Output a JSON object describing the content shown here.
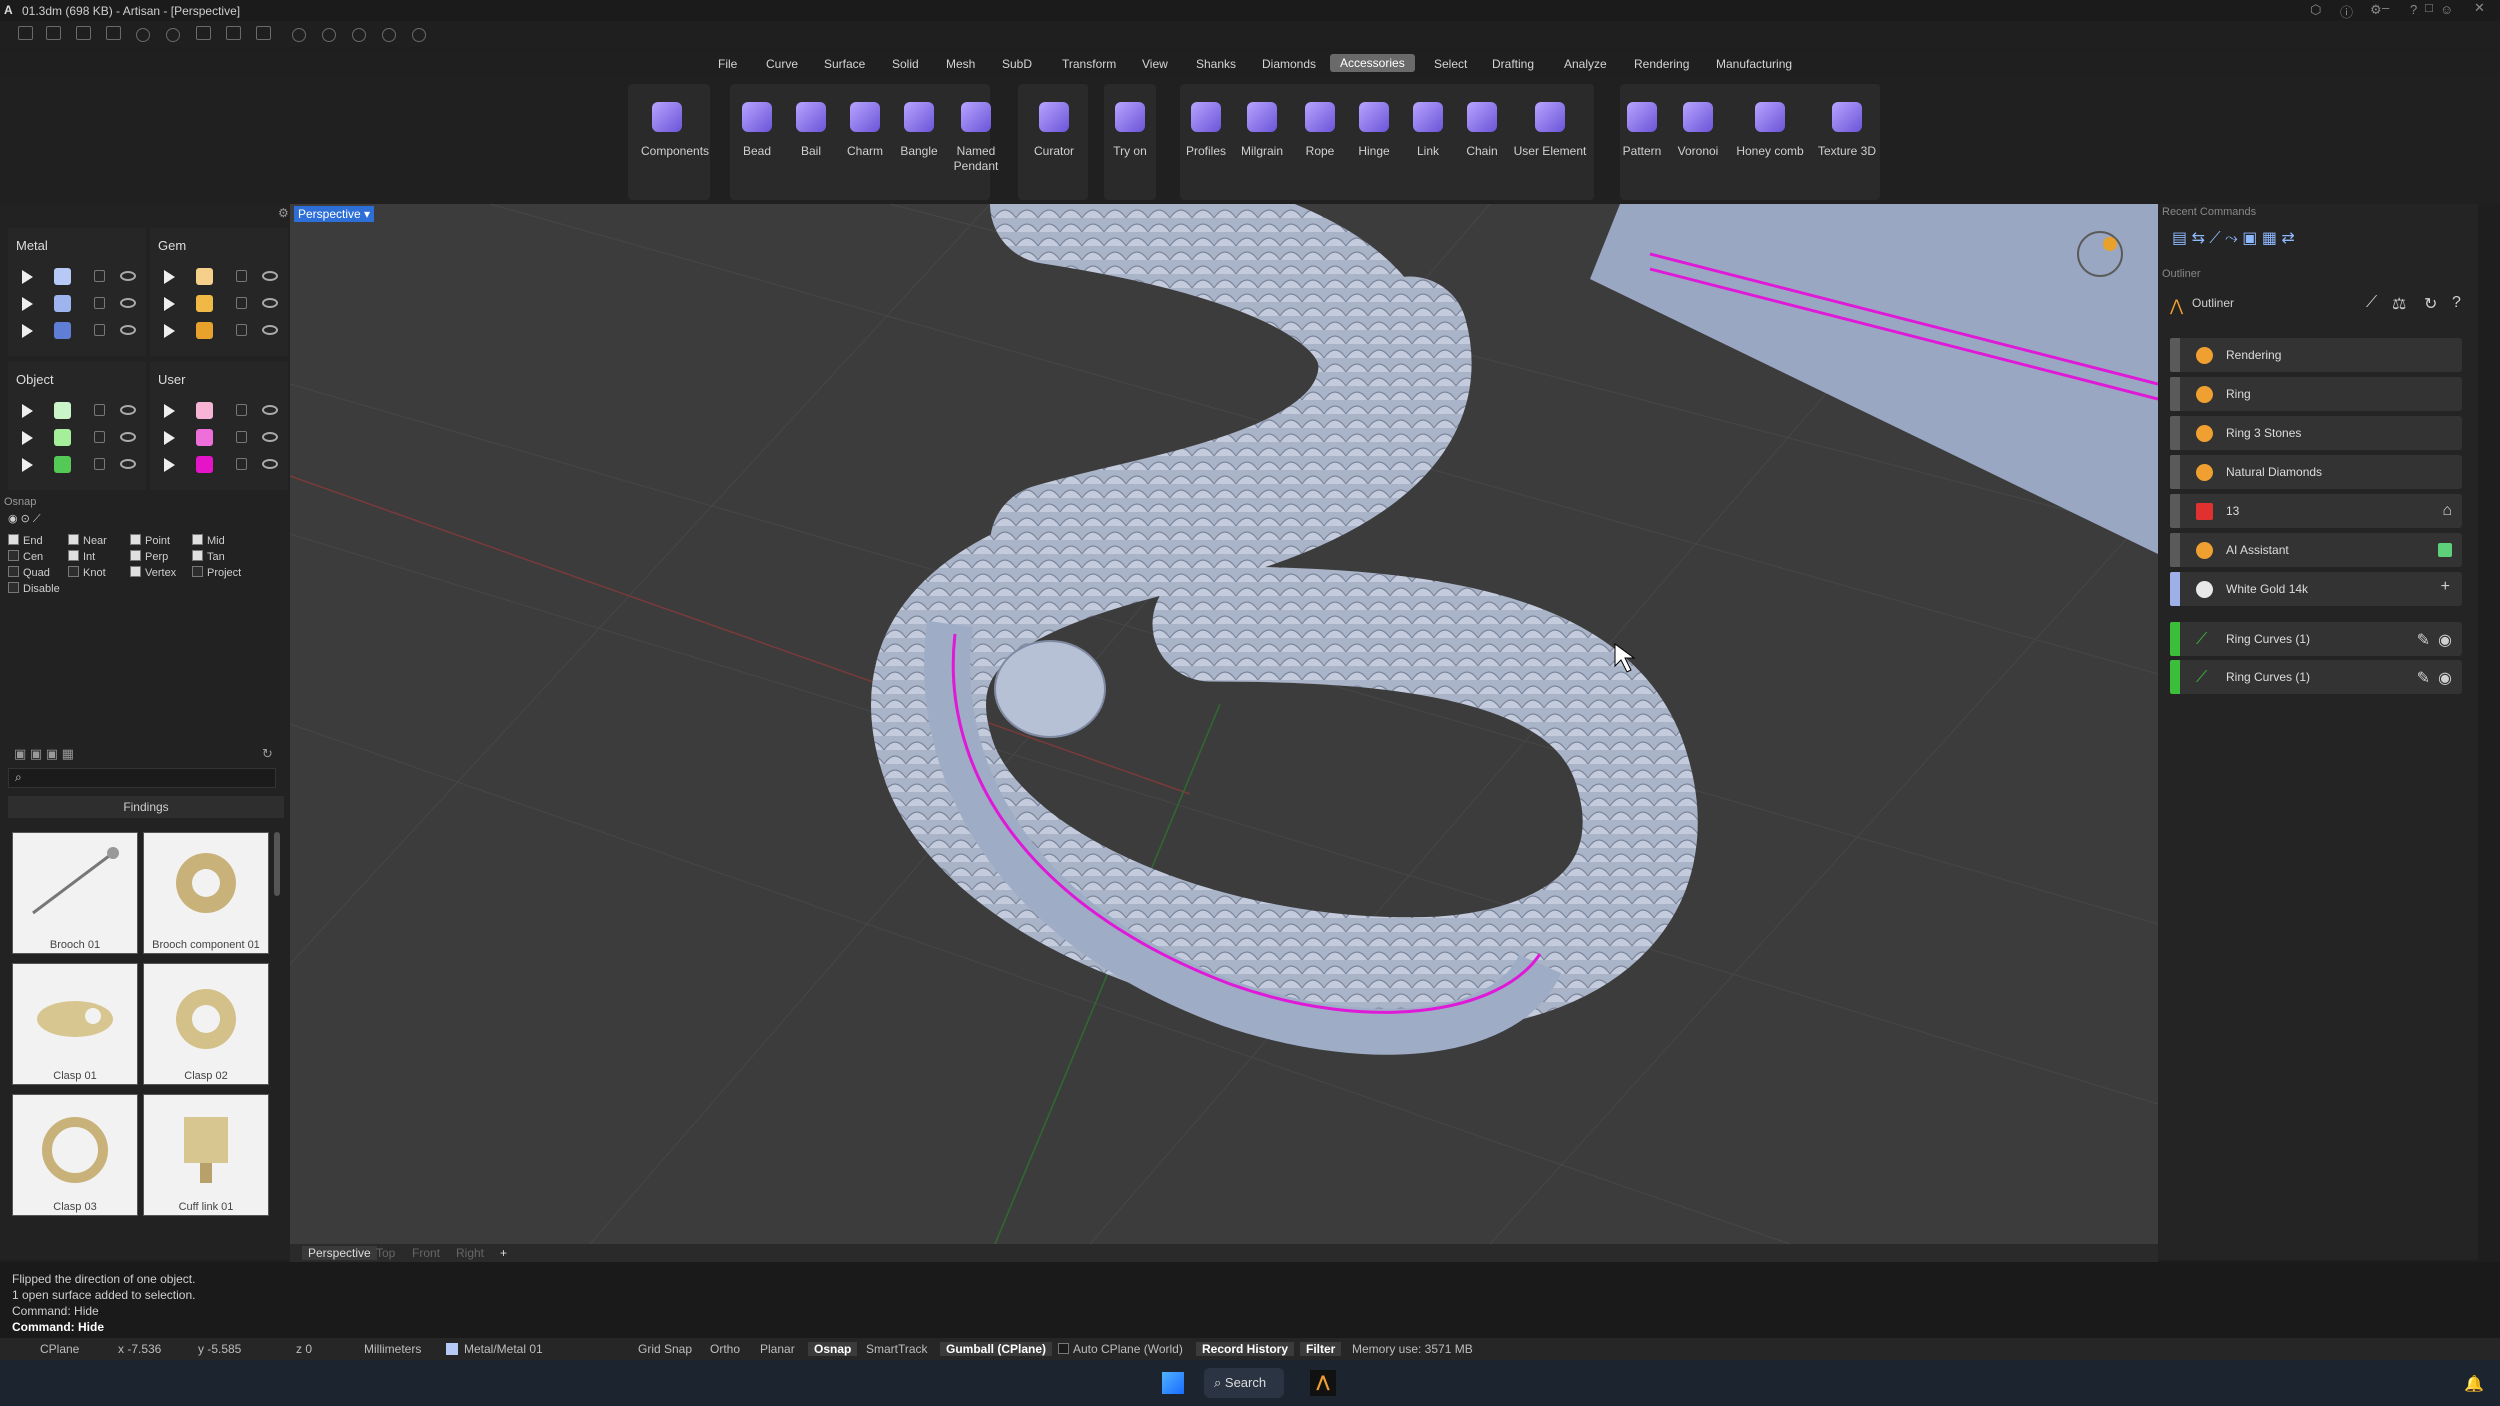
{
  "window": {
    "title": "01.3dm (698 KB) - Artisan - [Perspective]",
    "logo": "A"
  },
  "menubar": {
    "items": [
      "File",
      "Curve",
      "Surface",
      "Solid",
      "Mesh",
      "SubD",
      "Transform",
      "View",
      "Shanks",
      "Diamonds",
      "Accessories",
      "Select",
      "Drafting",
      "Analyze",
      "Rendering",
      "Manufacturing"
    ],
    "active": "Accessories"
  },
  "ribbon": {
    "buttons": [
      "Components",
      "Bead",
      "Bail",
      "Charm",
      "Bangle",
      "Named Pendant",
      "Curator",
      "Try on",
      "Profiles",
      "Milgrain",
      "Rope",
      "Hinge",
      "Link",
      "Chain",
      "User Element",
      "Pattern",
      "Voronoi",
      "Honey comb",
      "Texture 3D"
    ]
  },
  "layers": {
    "metal": {
      "title": "Metal",
      "swatches": [
        "#b7c9f5",
        "#9db4ee",
        "#5f7fd6"
      ]
    },
    "gem": {
      "title": "Gem",
      "swatches": [
        "#f5d08a",
        "#f0b945",
        "#e8a12a"
      ]
    },
    "object": {
      "title": "Object",
      "swatches": [
        "#c9f5c9",
        "#a6ef9a",
        "#55c955"
      ]
    },
    "user": {
      "title": "User",
      "swatches": [
        "#f7b4d4",
        "#ee6fd9",
        "#e614c8"
      ]
    }
  },
  "osnap": {
    "title": "Osnap",
    "items": [
      {
        "label": "End",
        "checked": true
      },
      {
        "label": "Near",
        "checked": true
      },
      {
        "label": "Point",
        "checked": true
      },
      {
        "label": "Mid",
        "checked": true
      },
      {
        "label": "Cen",
        "checked": false
      },
      {
        "label": "Int",
        "checked": true
      },
      {
        "label": "Perp",
        "checked": true
      },
      {
        "label": "Tan",
        "checked": true
      },
      {
        "label": "Quad",
        "checked": false
      },
      {
        "label": "Knot",
        "checked": false
      },
      {
        "label": "Vertex",
        "checked": true
      },
      {
        "label": "Project",
        "checked": false
      },
      {
        "label": "Disable",
        "checked": false
      }
    ]
  },
  "library": {
    "category": "Findings",
    "items": [
      "Brooch 01",
      "Brooch component 01",
      "Clasp 01",
      "Clasp 02",
      "Clasp 03",
      "Cuff link 01"
    ]
  },
  "viewport": {
    "label": "Perspective",
    "tabs": [
      "Perspective",
      "Top",
      "Front",
      "Right",
      "+"
    ]
  },
  "rightpanel": {
    "recent_title": "Recent Commands",
    "outliner_header": "Outliner",
    "outliner_title": "Outliner",
    "rows": [
      {
        "label": "Rendering",
        "bar": "#5a5a5a",
        "icon": "#f0a030"
      },
      {
        "label": "Ring",
        "bar": "#5a5a5a",
        "icon": "#f0a030"
      },
      {
        "label": "Ring 3 Stones",
        "bar": "#5a5a5a",
        "icon": "#f0a030"
      },
      {
        "label": "Natural Diamonds",
        "bar": "#5a5a5a",
        "icon": "#f0a030"
      },
      {
        "label": "13",
        "bar": "#5a5a5a",
        "icon": "#e03030"
      },
      {
        "label": "AI Assistant",
        "bar": "#5a5a5a",
        "icon": "#f0a030"
      },
      {
        "label": "White Gold 14k",
        "bar": "#9fb0e8",
        "icon": "#e8e8e8"
      },
      {
        "label": "Ring Curves (1)",
        "bar": "#3bbf3b",
        "icon": "#3bbf3b"
      },
      {
        "label": "Ring Curves (1)",
        "bar": "#3bbf3b",
        "icon": "#3bbf3b"
      }
    ]
  },
  "command": {
    "lines": [
      "Flipped the direction of one object.",
      "1 open surface added to selection.",
      "Command: Hide"
    ],
    "prompt": "Command: Hide"
  },
  "status": {
    "cplane": "CPlane",
    "x": "x -7.536",
    "y": "y -5.585",
    "z": "z 0",
    "units": "Millimeters",
    "layer": "Metal/Metal 01",
    "toggles": [
      "Grid Snap",
      "Ortho",
      "Planar",
      "Osnap",
      "SmartTrack",
      "Gumball (CPlane)",
      "Auto CPlane (World)",
      "Record History",
      "Filter"
    ],
    "memory": "Memory use: 3571 MB"
  },
  "taskbar": {
    "search": "Search"
  }
}
